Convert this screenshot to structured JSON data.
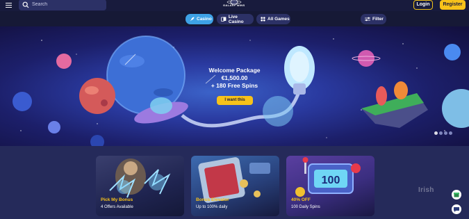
{
  "header": {
    "search": {
      "placeholder": "Search"
    },
    "logo_text": "GALAXY WINS",
    "login_label": "Login",
    "register_label": "Register"
  },
  "nav": {
    "tabs": [
      {
        "label": "Casino",
        "icon": "rocket-icon",
        "active": true
      },
      {
        "label": "Live Casino",
        "icon": "cards-icon",
        "active": false
      },
      {
        "label": "All Games",
        "icon": "grid-icon",
        "active": false
      }
    ],
    "filter_label": "Filter"
  },
  "hero": {
    "title_line1": "Welcome Package",
    "title_line2": "€1,500.00",
    "title_line3": "+ 180 Free Spins",
    "cta_label": "I want this",
    "slides_total": 4,
    "slide_active": 1
  },
  "promos": [
    {
      "title": "Pick My Bonus",
      "subtitle": "4 Offers Available"
    },
    {
      "title": "Bonus Elevator",
      "subtitle": "Up to 100% daily"
    },
    {
      "title": "40% OFF",
      "subtitle": "100 Daily Spins"
    }
  ],
  "card_art_text": "100",
  "watermark": "Irish",
  "colors": {
    "accent_yellow": "#f7c21a",
    "tab_active": "#3ea2e6",
    "header_bg": "#181b3d",
    "page_bg": "#252a5a"
  }
}
